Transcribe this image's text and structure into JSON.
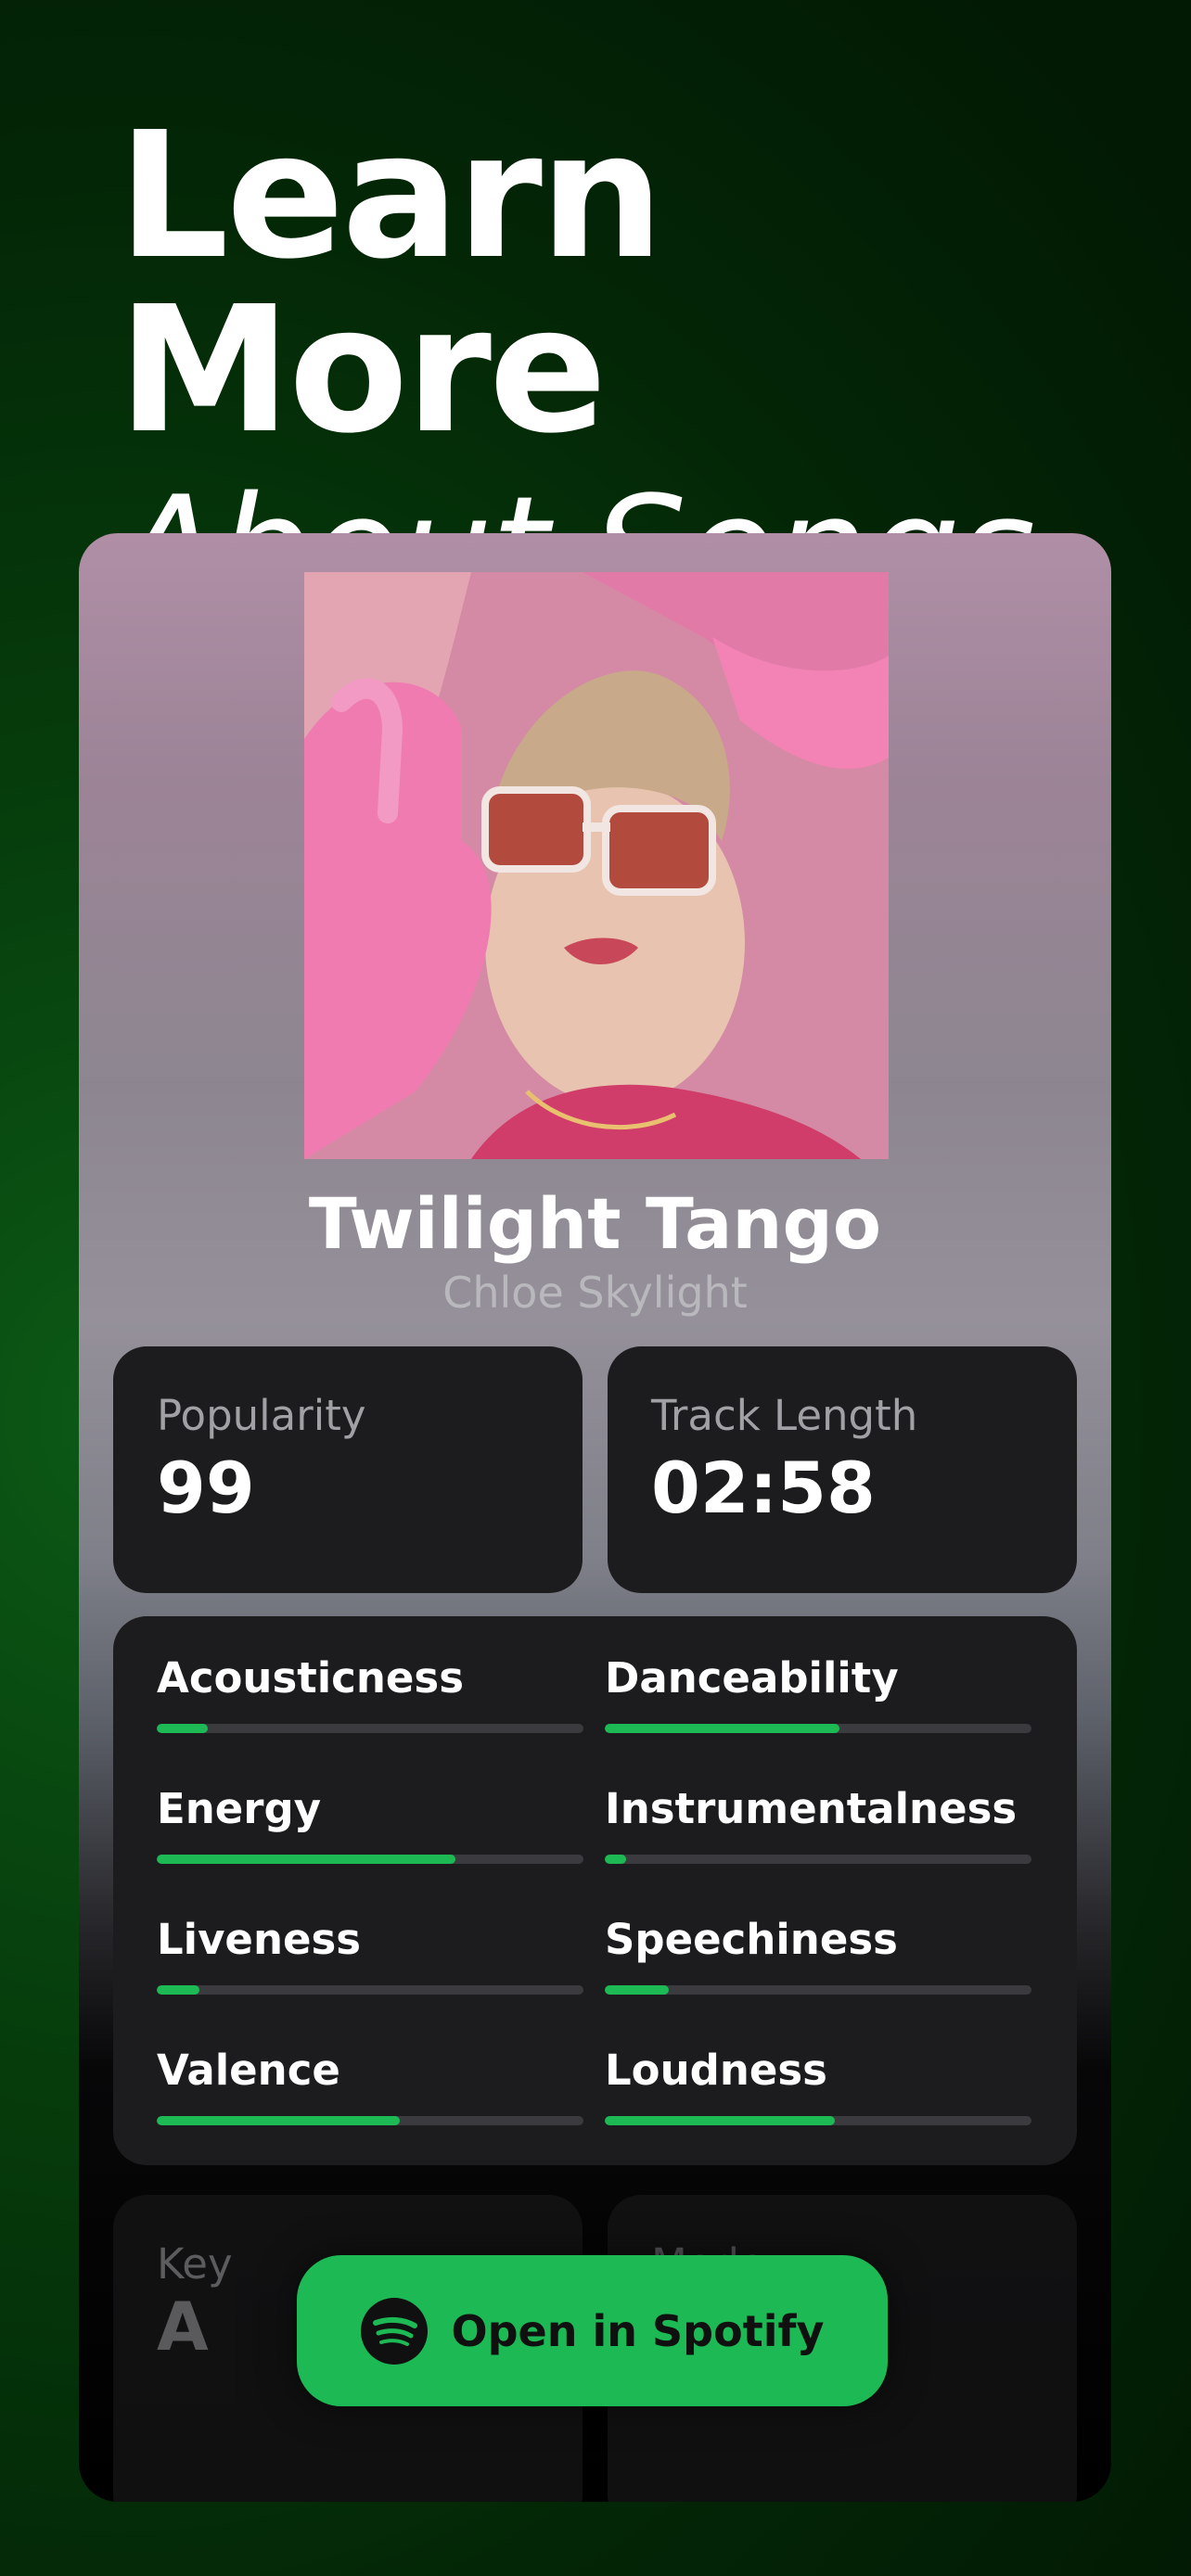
{
  "headline": {
    "line1": "Learn More",
    "line2": "About Songs"
  },
  "song": {
    "title": "Twilight Tango",
    "artist": "Chloe Skylight"
  },
  "stats": {
    "popularity": {
      "label": "Popularity",
      "value": "99"
    },
    "track_length": {
      "label": "Track Length",
      "value": "02:58"
    }
  },
  "features": [
    {
      "name": "Acousticness",
      "value": 0.12
    },
    {
      "name": "Danceability",
      "value": 0.55
    },
    {
      "name": "Energy",
      "value": 0.7
    },
    {
      "name": "Instrumentalness",
      "value": 0.05
    },
    {
      "name": "Liveness",
      "value": 0.1
    },
    {
      "name": "Speechiness",
      "value": 0.15
    },
    {
      "name": "Valence",
      "value": 0.57
    },
    {
      "name": "Loudness",
      "value": 0.54
    }
  ],
  "key_tile": {
    "label": "Key",
    "value": "A"
  },
  "mode_tile": {
    "label": "Mode"
  },
  "cta": {
    "label": "Open in Spotify",
    "icon": "spotify-icon"
  },
  "colors": {
    "accent": "#1db954",
    "tile": "#1c1c1e"
  }
}
